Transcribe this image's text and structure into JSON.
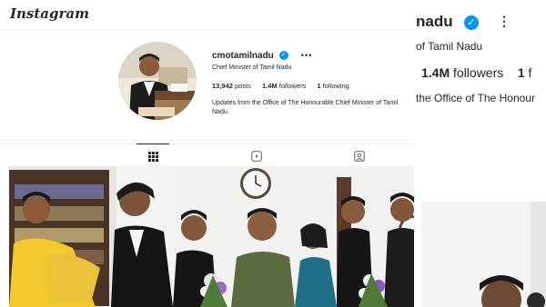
{
  "app": {
    "logo_text": "Instagram"
  },
  "profile": {
    "username": "cmotamilnadu",
    "subtitle": "Chief Minister of Tamil Nadu",
    "stats": {
      "posts_count": "13,942",
      "posts_label": "posts",
      "followers_count": "1.4M",
      "followers_label": "followers",
      "following_count": "1",
      "following_label": "following"
    },
    "bio": "Updates from the Office of The Honourable Chief Minister of Tamil Nadu."
  },
  "tabs": [
    {
      "name": "posts",
      "icon": "grid-icon",
      "active": true
    },
    {
      "name": "reels",
      "icon": "reels-icon",
      "active": false
    },
    {
      "name": "tagged",
      "icon": "tagged-icon",
      "active": false
    }
  ],
  "zoom": {
    "username_fragment": "nadu",
    "subtitle_fragment": "of Tamil Nadu",
    "followers_count": "1.4M",
    "followers_label": "followers",
    "following_count": "1",
    "following_fragment": "f",
    "bio_fragment": "the Office of The Honour"
  },
  "colors": {
    "verified": "#0095f6",
    "text": "#262626",
    "divider": "#efefef"
  }
}
